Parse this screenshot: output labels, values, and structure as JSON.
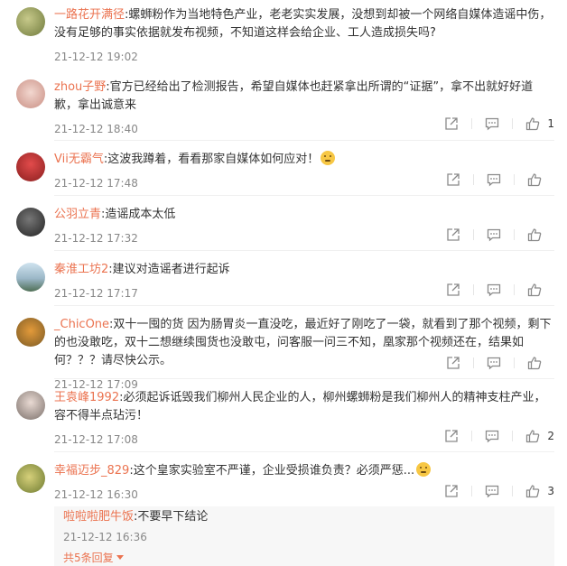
{
  "comments": [
    {
      "user": "一路花开满径",
      "text": ":螺蛳粉作为当地特色产业，老老实实发展，没想到却被一个网络自媒体造谣中伤，没有足够的事实依据就发布视频，不知道这样会给企业、工人造成损失吗?",
      "time": "21-12-12 19:02",
      "likes": ""
    },
    {
      "user": "zhou子野",
      "text": ":官方已经给出了检测报告，希望自媒体也赶紧拿出所谓的“证据”，拿不出就好好道歉，拿出诚意来",
      "time": "21-12-12 18:40",
      "likes": "1"
    },
    {
      "user": "Vii无霸气",
      "text": ":这波我蹲着，看看那家自媒体如何应对！",
      "time": "21-12-12 17:48",
      "likes": ""
    },
    {
      "user": "公羽立青",
      "text": ":造谣成本太低",
      "time": "21-12-12 17:32",
      "likes": ""
    },
    {
      "user": "秦淮工坊2",
      "text": ":建议对造谣者进行起诉",
      "time": "21-12-12 17:17",
      "likes": ""
    },
    {
      "user": "_ChicOne",
      "text": ":双十一囤的货 因为肠胃炎一直没吃，最近好了刚吃了一袋，就看到了那个视频，剩下的也没敢吃，双十二想继续囤货也没敢屯，问客服一问三不知，凰家那个视频还在，结果如何？？？请尽快公示。",
      "time": "21-12-12 17:09",
      "likes": ""
    },
    {
      "user": "王袁峰1992",
      "text": ":必须起诉诋毁我们柳州人民企业的人，柳州螺蛳粉是我们柳州人的精神支柱产业，容不得半点玷污！",
      "time": "21-12-12 17:08",
      "likes": "2"
    },
    {
      "user": "幸福迈步_829",
      "text": ":这个皇家实验室不严谨，企业受损谁负责？必须严惩...",
      "time": "21-12-12 16:30",
      "likes": "3"
    }
  ],
  "reply": {
    "user": "啦啦啦肥牛饭",
    "text": ":不要早下结论",
    "time": "21-12-12 16:36"
  },
  "more_replies": "共5条回复",
  "icons": {
    "share": "share-icon",
    "comment": "comment-icon",
    "like": "thumbs-up-icon"
  },
  "colors": {
    "username": "#eb7350",
    "time": "#888888",
    "icon": "#8a8a8a"
  }
}
